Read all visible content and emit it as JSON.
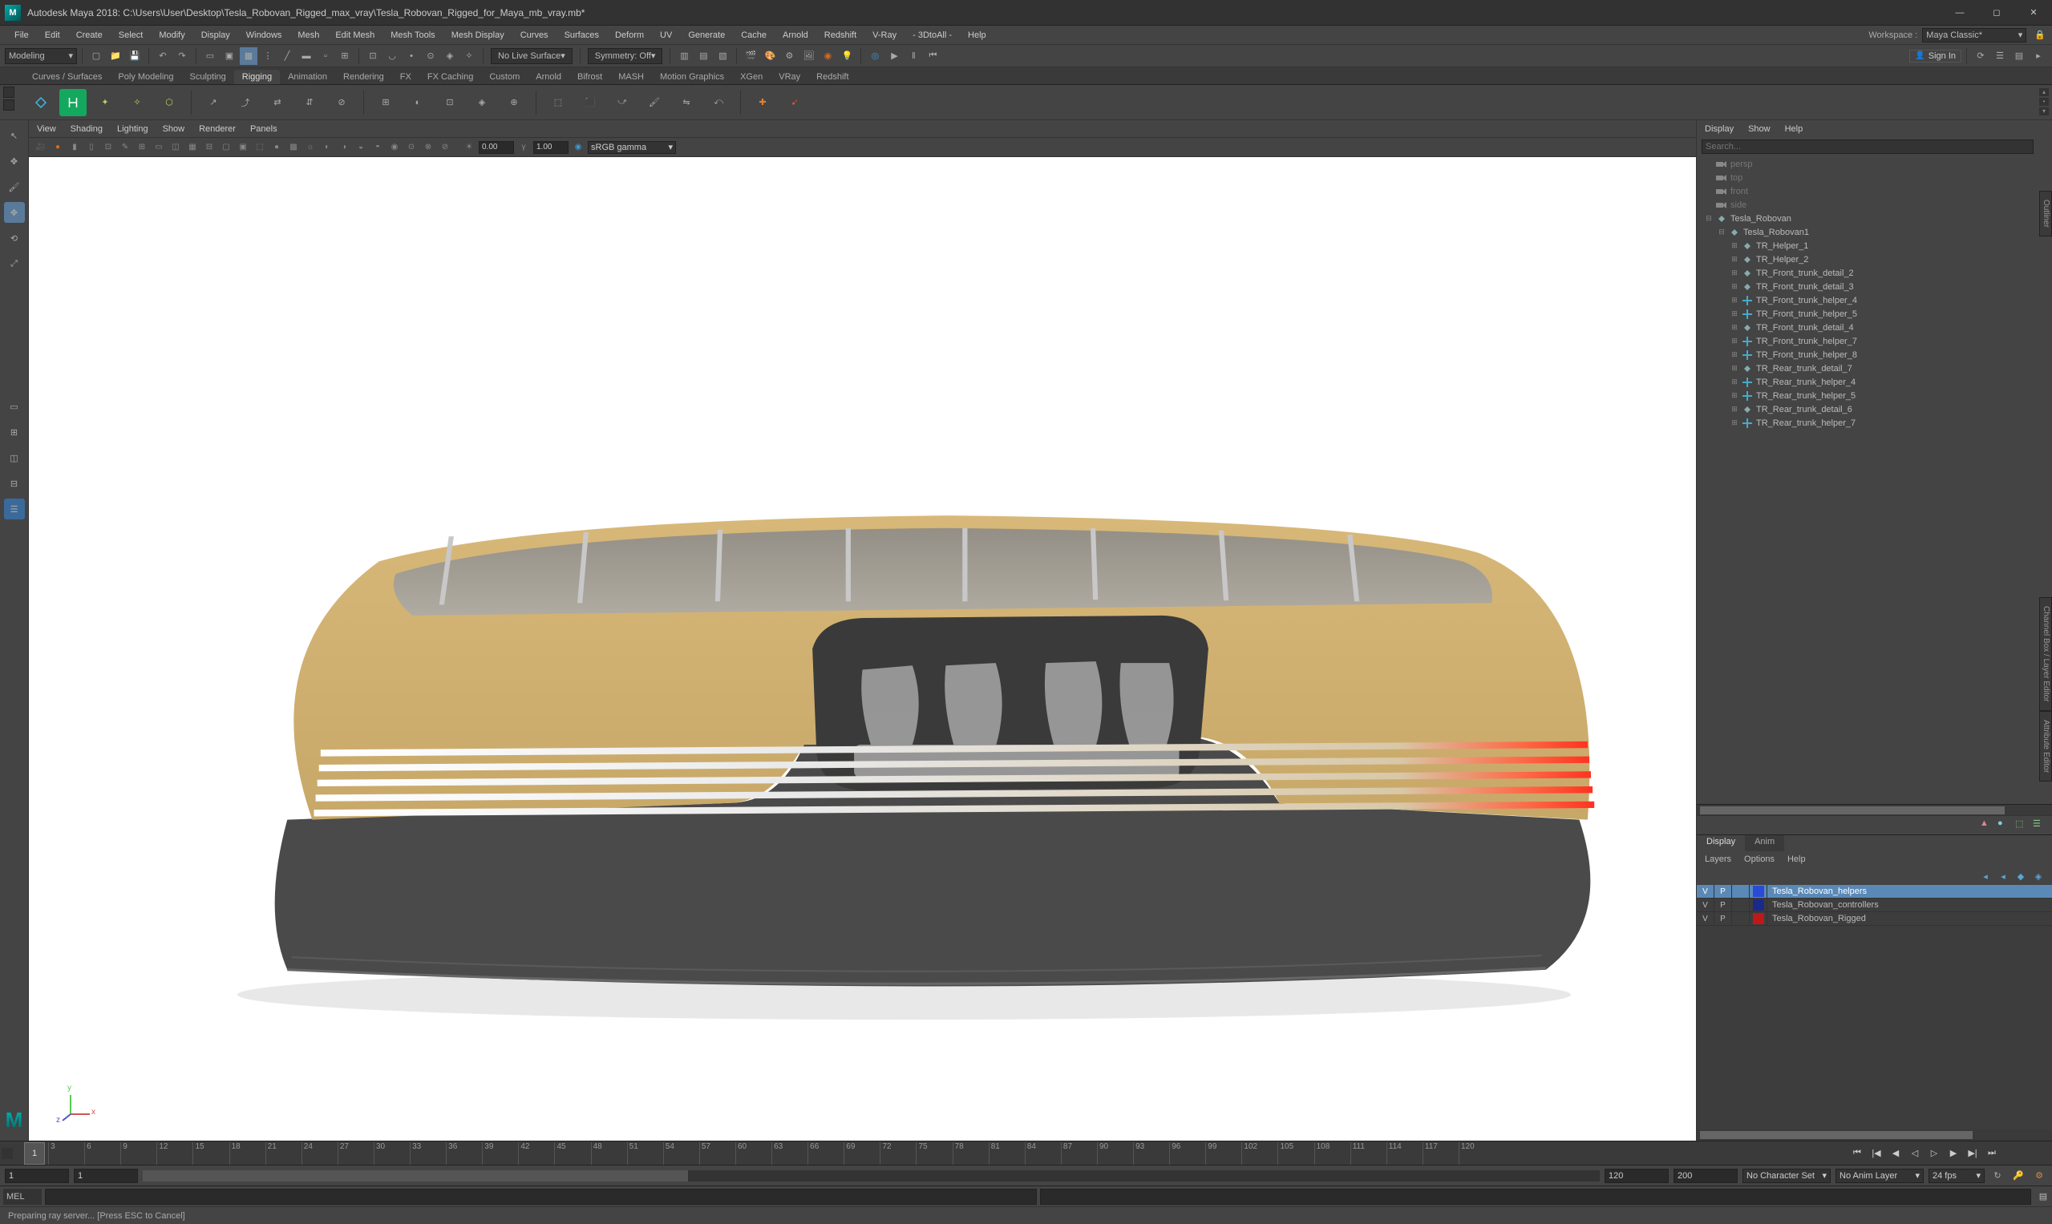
{
  "title": "Autodesk Maya 2018: C:\\Users\\User\\Desktop\\Tesla_Robovan_Rigged_max_vray\\Tesla_Robovan_Rigged_for_Maya_mb_vray.mb*",
  "menus": [
    "File",
    "Edit",
    "Create",
    "Select",
    "Modify",
    "Display",
    "Windows",
    "Mesh",
    "Edit Mesh",
    "Mesh Tools",
    "Mesh Display",
    "Curves",
    "Surfaces",
    "Deform",
    "UV",
    "Generate",
    "Cache",
    "Arnold",
    "Redshift",
    "V-Ray",
    "- 3DtoAll -",
    "Help"
  ],
  "workspace_label": "Workspace :",
  "workspace": "Maya Classic*",
  "modeset": "Modeling",
  "nolive": "No Live Surface",
  "symmetry": "Symmetry: Off",
  "signin": "Sign In",
  "shelf_tabs": [
    "Curves / Surfaces",
    "Poly Modeling",
    "Sculpting",
    "Rigging",
    "Animation",
    "Rendering",
    "FX",
    "FX Caching",
    "Custom",
    "Arnold",
    "Bifrost",
    "MASH",
    "Motion Graphics",
    "XGen",
    "VRay",
    "Redshift"
  ],
  "shelf_active": 3,
  "panel_menu": [
    "View",
    "Shading",
    "Lighting",
    "Show",
    "Renderer",
    "Panels"
  ],
  "view_exposure": "0.00",
  "view_gamma": "1.00",
  "view_colorspace": "sRGB gamma",
  "outliner_menu": [
    "Display",
    "Show",
    "Help"
  ],
  "outliner_search_ph": "Search...",
  "outliner_cams": [
    "persp",
    "top",
    "front",
    "side"
  ],
  "outliner_root": "Tesla_Robovan",
  "outliner_sub": "Tesla_Robovan1",
  "outliner_children": [
    {
      "n": "TR_Helper_1",
      "t": "g"
    },
    {
      "n": "TR_Helper_2",
      "t": "g"
    },
    {
      "n": "TR_Front_trunk_detail_2",
      "t": "g"
    },
    {
      "n": "TR_Front_trunk_detail_3",
      "t": "g"
    },
    {
      "n": "TR_Front_trunk_helper_4",
      "t": "l"
    },
    {
      "n": "TR_Front_trunk_helper_5",
      "t": "l"
    },
    {
      "n": "TR_Front_trunk_detail_4",
      "t": "g"
    },
    {
      "n": "TR_Front_trunk_helper_7",
      "t": "l"
    },
    {
      "n": "TR_Front_trunk_helper_8",
      "t": "l"
    },
    {
      "n": "TR_Rear_trunk_detail_7",
      "t": "g"
    },
    {
      "n": "TR_Rear_trunk_helper_4",
      "t": "l"
    },
    {
      "n": "TR_Rear_trunk_helper_5",
      "t": "l"
    },
    {
      "n": "TR_Rear_trunk_detail_6",
      "t": "g"
    },
    {
      "n": "TR_Rear_trunk_helper_7",
      "t": "l"
    }
  ],
  "layer_tabs": [
    "Display",
    "Anim"
  ],
  "layer_menu": [
    "Layers",
    "Options",
    "Help"
  ],
  "layers": [
    {
      "v": "V",
      "p": "P",
      "color": "#2a4bd7",
      "name": "Tesla_Robovan_helpers",
      "sel": true
    },
    {
      "v": "V",
      "p": "P",
      "color": "#1a2a8a",
      "name": "Tesla_Robovan_controllers",
      "sel": false
    },
    {
      "v": "V",
      "p": "P",
      "color": "#c01818",
      "name": "Tesla_Robovan_Rigged",
      "sel": false
    }
  ],
  "time_ticks": [
    3,
    6,
    9,
    12,
    15,
    18,
    21,
    24,
    27,
    30,
    33,
    36,
    39,
    42,
    45,
    48,
    51,
    54,
    57,
    60,
    63,
    66,
    69,
    72,
    75,
    78,
    81,
    84,
    87,
    90,
    93,
    96,
    99,
    102,
    105,
    108,
    111,
    114,
    117,
    120
  ],
  "time_cur": "1",
  "range_start": "1",
  "range_in": "1",
  "range_out": "120",
  "range_end": "120",
  "range_max": "200",
  "charset": "No Character Set",
  "animlayer": "No Anim Layer",
  "fps": "24 fps",
  "cmd_lang": "MEL",
  "status_text": "Preparing ray server... [Press ESC to Cancel]",
  "axis": {
    "x": "x",
    "y": "y",
    "z": "z"
  }
}
